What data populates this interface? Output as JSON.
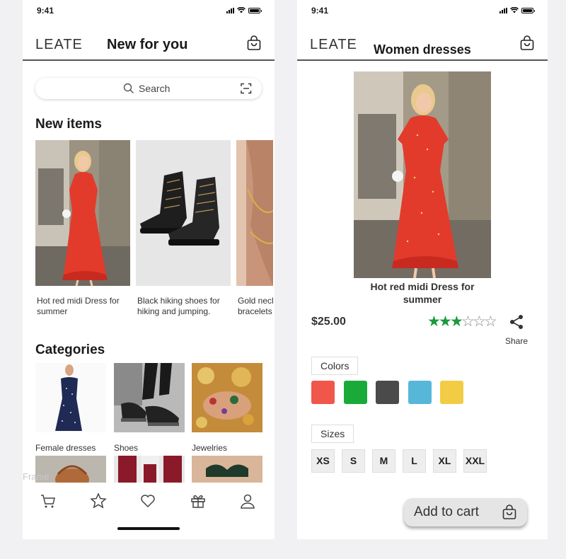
{
  "status": {
    "time": "9:41"
  },
  "screen1": {
    "logo": "LEATE",
    "title": "New for you",
    "search_placeholder": "Search",
    "new_items_title": "New items",
    "new_items": [
      {
        "line1": "Hot red midi Dress for",
        "line2": "summer",
        "image": "red-dress-photo"
      },
      {
        "line1": "Black hiking shoes for",
        "line2": "hiking and jumping.",
        "image": "black-boots-photo"
      },
      {
        "line1": "Gold necl",
        "line2": "bracelets",
        "image": "gold-jewelry-photo"
      }
    ],
    "categories_title": "Categories",
    "categories": [
      {
        "label": "Female dresses",
        "image": "navy-dress-photo"
      },
      {
        "label": "Shoes",
        "image": "sneakers-photo"
      },
      {
        "label": "Jewelries",
        "image": "jewelry-photo"
      }
    ],
    "watermark": "Frame",
    "tabs": [
      "cart-icon",
      "star-icon",
      "heart-icon",
      "gift-icon",
      "user-icon"
    ]
  },
  "screen2": {
    "logo": "LEATE",
    "title": "Women dresses",
    "product_name_line1": "Hot red midi Dress for",
    "product_name_line2": "summer",
    "price": "$25.00",
    "rating": 3,
    "rating_max": 6,
    "share_label": "Share",
    "colors_label": "Colors",
    "colors": [
      "#f0574a",
      "#1aaa3a",
      "#4a4a4a",
      "#57b7d9",
      "#f3cc45"
    ],
    "sizes_label": "Sizes",
    "sizes": [
      "XS",
      "S",
      "M",
      "L",
      "XL",
      "XXL"
    ],
    "add_to_cart": "Add to cart"
  }
}
